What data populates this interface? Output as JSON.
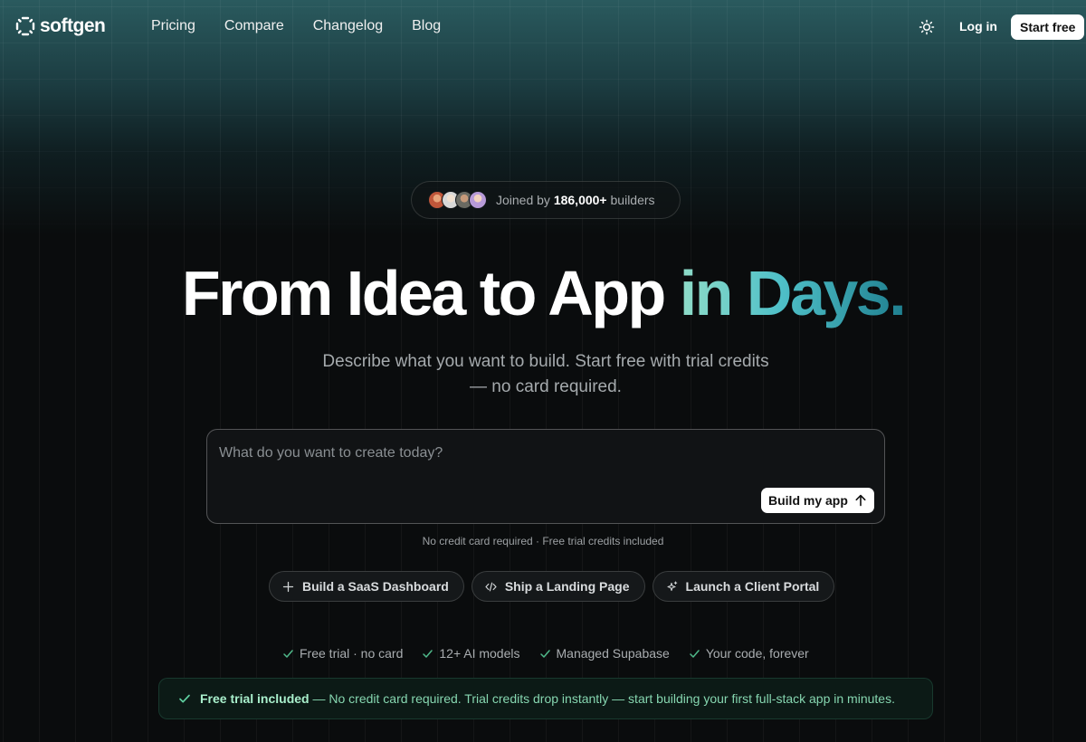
{
  "nav": {
    "logo_text": "softgen",
    "links": [
      "Pricing",
      "Compare",
      "Changelog",
      "Blog"
    ],
    "login_label": "Log in",
    "start_label": "Start free"
  },
  "social_proof": {
    "prefix": "Joined by",
    "count": "186,000+",
    "suffix": "builders"
  },
  "hero": {
    "headline_main": "From Idea to App",
    "headline_accent": "in Days.",
    "subhead": "Describe what you want to build. Start free with trial credits — no card required."
  },
  "prompt": {
    "placeholder": "What do you want to create today?",
    "button_label": "Build my app"
  },
  "note": "No credit card required · Free trial credits included",
  "suggestions": [
    {
      "label": "Build a SaaS Dashboard",
      "icon": "plus-icon"
    },
    {
      "label": "Ship a Landing Page",
      "icon": "code-icon"
    },
    {
      "label": "Launch a Client Portal",
      "icon": "sparkles-icon"
    }
  ],
  "features": [
    "Free trial · no card",
    "12+ AI models",
    "Managed Supabase",
    "Your code, forever"
  ],
  "banner": {
    "strong": "Free trial included",
    "text": " — No credit card required. Trial credits drop instantly — start building your first full-stack app in minutes."
  },
  "colors": {
    "accent_start": "#8fdcc8",
    "accent_end": "#1f7f8f",
    "check_green": "#4fb88a"
  }
}
